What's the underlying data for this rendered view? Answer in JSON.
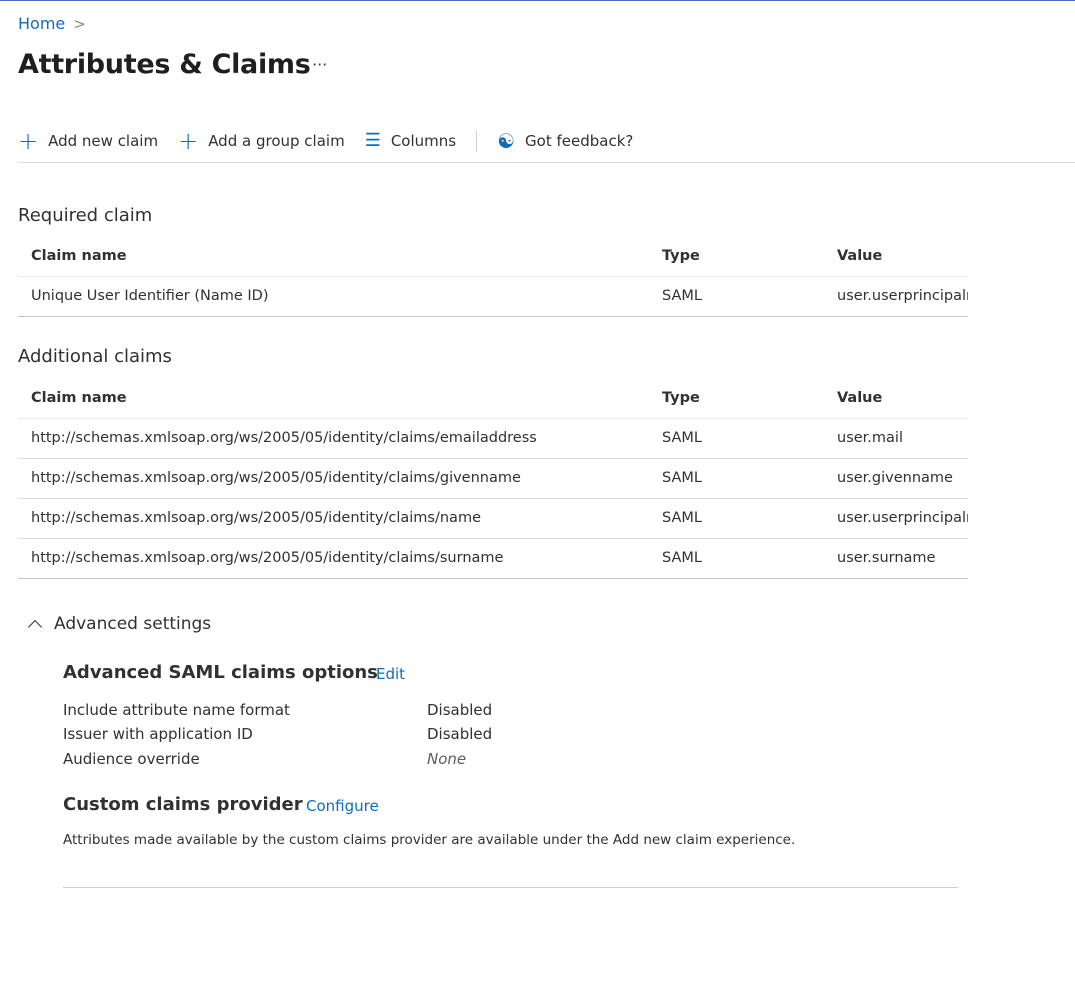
{
  "breadcrumb": {
    "home": "Home",
    "separator": ">"
  },
  "page": {
    "title": "Attributes & Claims",
    "more": "···"
  },
  "toolbar": {
    "add_new_claim": "Add new claim",
    "add_group_claim": "Add a group claim",
    "columns": "Columns",
    "feedback": "Got feedback?"
  },
  "required": {
    "title": "Required claim",
    "headers": [
      "Claim name",
      "Type",
      "Value"
    ],
    "rows": [
      {
        "name": "Unique User Identifier (Name ID)",
        "type": "SAML",
        "value": "user.userprincipalname"
      }
    ]
  },
  "additional": {
    "title": "Additional claims",
    "headers": [
      "Claim name",
      "Type",
      "Value"
    ],
    "rows": [
      {
        "name": "http://schemas.xmlsoap.org/ws/2005/05/identity/claims/emailaddress",
        "type": "SAML",
        "value": "user.mail"
      },
      {
        "name": "http://schemas.xmlsoap.org/ws/2005/05/identity/claims/givenname",
        "type": "SAML",
        "value": "user.givenname"
      },
      {
        "name": "http://schemas.xmlsoap.org/ws/2005/05/identity/claims/name",
        "type": "SAML",
        "value": "user.userprincipalname"
      },
      {
        "name": "http://schemas.xmlsoap.org/ws/2005/05/identity/claims/surname",
        "type": "SAML",
        "value": "user.surname"
      }
    ]
  },
  "advanced": {
    "toggle": "Advanced settings",
    "saml": {
      "title": "Advanced SAML claims options",
      "edit": "Edit",
      "items": [
        {
          "label": "Include attribute name format",
          "value": "Disabled"
        },
        {
          "label": "Issuer with application ID",
          "value": "Disabled"
        },
        {
          "label": "Audience override",
          "value": "None"
        }
      ]
    },
    "custom": {
      "title": "Custom claims provider",
      "configure": "Configure",
      "note": "Attributes made available by the custom claims provider are available under the Add new claim experience."
    }
  }
}
